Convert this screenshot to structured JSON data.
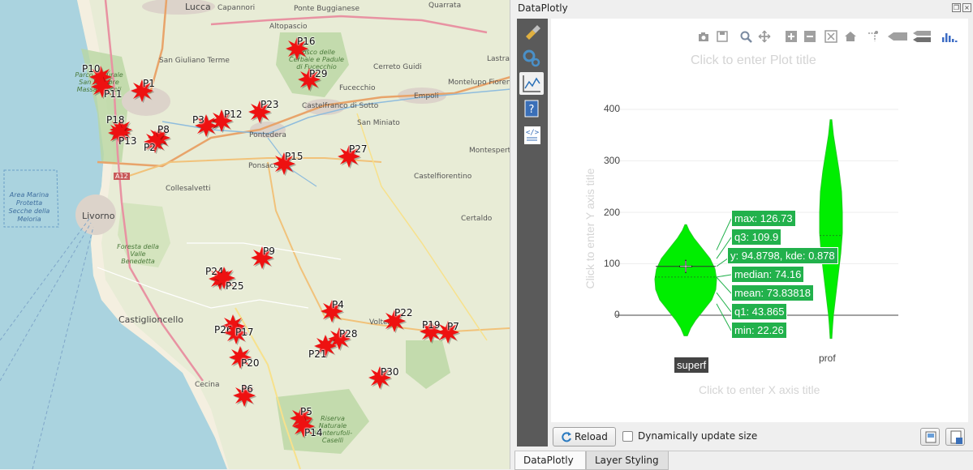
{
  "map": {
    "places": [
      {
        "name": "Lucca"
      },
      {
        "name": "Capannori"
      },
      {
        "name": "Ponte Buggianese"
      },
      {
        "name": "Quarrata"
      },
      {
        "name": "Altopascio"
      },
      {
        "name": "Lastra"
      },
      {
        "name": "San Giuliano Terme"
      },
      {
        "name": "Cerreto Guidi"
      },
      {
        "name": "Fucecchio"
      },
      {
        "name": "Montelupo Fiorentino"
      },
      {
        "name": "Empoli"
      },
      {
        "name": "Castelfranco di Sotto"
      },
      {
        "name": "Pontedera"
      },
      {
        "name": "San Miniato"
      },
      {
        "name": "Montespert"
      },
      {
        "name": "Ponsacco"
      },
      {
        "name": "Castelfiorentino"
      },
      {
        "name": "Collesalvetti"
      },
      {
        "name": "Livorno"
      },
      {
        "name": "Certaldo"
      },
      {
        "name": "Castiglioncello"
      },
      {
        "name": "Volterra"
      },
      {
        "name": "Cecina"
      },
      {
        "name": "A12"
      }
    ],
    "green_labels": [
      {
        "text": "Parco Naturale San Rossore Massaciuccoli"
      },
      {
        "text": "Bosco delle Cerbaie e Padule di Fucecchio"
      },
      {
        "text": "Foresta della Valle Benedetta"
      },
      {
        "text": "Riserva Naturale Monterufoli-Caselli"
      }
    ],
    "sea_label": "Area Marina Protetta Secche della Meloria",
    "markers": [
      {
        "label": "P16"
      },
      {
        "label": "P29"
      },
      {
        "label": "P10"
      },
      {
        "label": "P11"
      },
      {
        "label": "P1"
      },
      {
        "label": "P23"
      },
      {
        "label": "P12"
      },
      {
        "label": "P3"
      },
      {
        "label": "P18"
      },
      {
        "label": "P8"
      },
      {
        "label": "P13"
      },
      {
        "label": "P2"
      },
      {
        "label": "P15"
      },
      {
        "label": "P27"
      },
      {
        "label": "P9"
      },
      {
        "label": "P24"
      },
      {
        "label": "P25"
      },
      {
        "label": "P4"
      },
      {
        "label": "P22"
      },
      {
        "label": "P19"
      },
      {
        "label": "P7"
      },
      {
        "label": "P26"
      },
      {
        "label": "P17"
      },
      {
        "label": "P28"
      },
      {
        "label": "P21"
      },
      {
        "label": "P20"
      },
      {
        "label": "P30"
      },
      {
        "label": "P6"
      },
      {
        "label": "P5"
      },
      {
        "label": "P14"
      }
    ],
    "marker_color": "#ee1111"
  },
  "dock": {
    "title": "DataPlotly",
    "sidebar_icons": [
      "brush-icon",
      "gears-icon",
      "chart-icon",
      "help-icon",
      "code-icon"
    ],
    "plot": {
      "title_placeholder": "Click to enter Plot title",
      "x_placeholder": "Click to enter X axis title",
      "y_placeholder": "Click to enter Y axis title",
      "modebar_icons": [
        "camera-icon",
        "save-icon",
        "zoom-icon",
        "pan-icon",
        "zoom-in-icon",
        "zoom-out-icon",
        "autoscale-icon",
        "home-icon",
        "spikelines-icon",
        "hover-closest-icon",
        "hover-compare-icon",
        "plotly-logo-icon"
      ],
      "hover_labels": [
        "max: 126.73",
        "q3: 109.9",
        "y: 94.8798, kde: 0.878",
        "median: 74.16",
        "mean: 73.83818",
        "q1: 43.865",
        "min: 22.26"
      ],
      "hover_x_label": "superf",
      "x_tick_prof": "prof",
      "fill_color": "#00ee00"
    },
    "reload_label": "Reload",
    "dynamic_label": "Dynamically update size",
    "tabs": [
      "DataPlotly",
      "Layer Styling"
    ]
  },
  "chart_data": {
    "type": "violin",
    "categories": [
      "superf",
      "prof"
    ],
    "series": [
      {
        "values_summary": {
          "max": 126.73,
          "q3": 109.9,
          "median": 74.16,
          "mean": 73.83818,
          "q1": 43.865,
          "min": 22.26
        }
      },
      {
        "values_summary": {}
      }
    ],
    "yticks": [
      0,
      100,
      200,
      300,
      400
    ],
    "ylim": [
      -40,
      420
    ],
    "xlabel": "",
    "ylabel": ""
  }
}
